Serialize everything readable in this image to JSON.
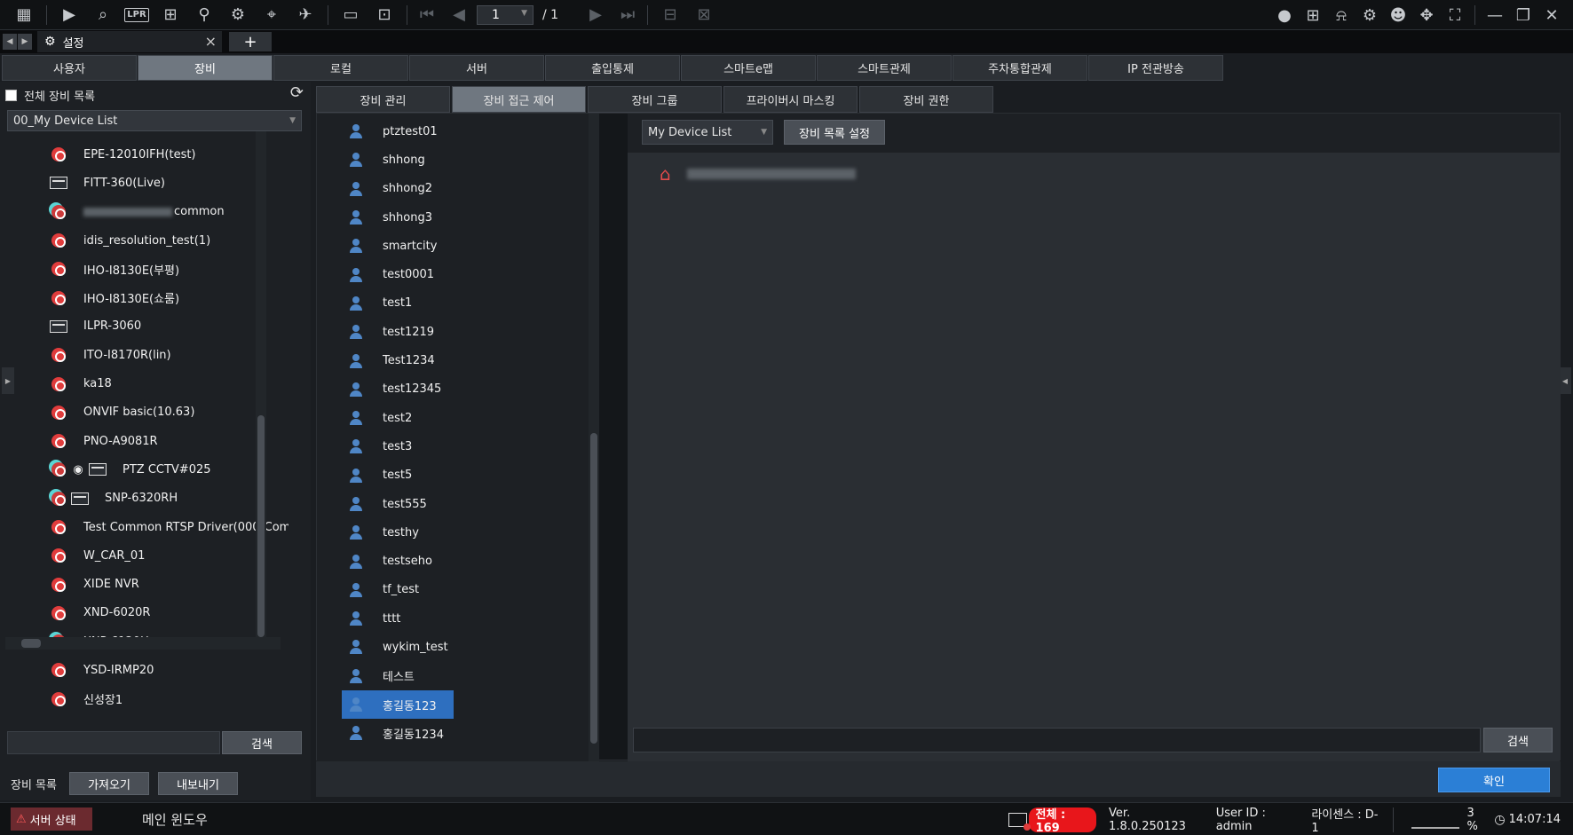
{
  "toolbar": {
    "icons_left": [
      "grid-icon",
      "playback-icon",
      "search-video-icon",
      "lpr-icon",
      "event-search-icon",
      "person-search-icon",
      "vehicle-icon",
      "map-icon",
      "broadcast-icon"
    ],
    "lpr_label": "LPR",
    "page_current": "1",
    "page_total": "/ 1",
    "icons_right": [
      "chat-icon",
      "event-icon",
      "alarm-icon",
      "gear-icon",
      "user-icon",
      "move-icon",
      "fullscreen-icon",
      "minimize-icon",
      "restore-icon",
      "close-icon"
    ]
  },
  "window_tab": {
    "label": "설정"
  },
  "main_tabs": [
    "사용자",
    "장비",
    "로컬",
    "서버",
    "출입통제",
    "스마트e맵",
    "스마트관제",
    "주차통합관제",
    "IP 전관방송"
  ],
  "main_tab_active": 1,
  "left": {
    "all_devices_label": "전체 장비 목록",
    "device_list_select": "00_My Device List",
    "devices": [
      {
        "name": "EPE-12010IFH(test)",
        "icon": "camera"
      },
      {
        "name": "FITT-360(Live)",
        "icon": "encoder"
      },
      {
        "name": "common",
        "icon": "ptz",
        "blurred": true
      },
      {
        "name": "idis_resolution_test(1)",
        "icon": "camera"
      },
      {
        "name": "IHO-I8130E(부평)",
        "icon": "camera"
      },
      {
        "name": "IHO-I8130E(쇼룸)",
        "icon": "camera"
      },
      {
        "name": "ILPR-3060",
        "icon": "encoder"
      },
      {
        "name": "ITO-I8170R(lin)",
        "icon": "camera"
      },
      {
        "name": "ka18",
        "icon": "camera"
      },
      {
        "name": "ONVIF basic(10.63)",
        "icon": "camera"
      },
      {
        "name": "PNO-A9081R",
        "icon": "camera"
      },
      {
        "name": "PTZ CCTV#025",
        "icon": "ptz-multi"
      },
      {
        "name": "SNP-6320RH",
        "icon": "ptz-encoder"
      },
      {
        "name": "Test Common RTSP Driver(000)Com",
        "icon": "camera"
      },
      {
        "name": "W_CAR_01",
        "icon": "camera"
      },
      {
        "name": "XIDE NVR",
        "icon": "camera"
      },
      {
        "name": "XND-6020R",
        "icon": "camera"
      },
      {
        "name": "XNP-6120H",
        "icon": "ptz"
      },
      {
        "name": "YSD-IRMP20",
        "icon": "camera"
      },
      {
        "name": "신성장1",
        "icon": "camera"
      }
    ],
    "search_button": "검색",
    "device_list_label": "장비 목록",
    "import_button": "가져오기",
    "export_button": "내보내기"
  },
  "sub_tabs": [
    "장비 관리",
    "장비 접근 제어",
    "장비 그룹",
    "프라이버시 마스킹",
    "장비 권한"
  ],
  "sub_tab_active": 1,
  "users": [
    "ptztest01",
    "shhong",
    "shhong2",
    "shhong3",
    "smartcity",
    "test0001",
    "test1",
    "test1219",
    "Test1234",
    "test12345",
    "test2",
    "test3",
    "test5",
    "test555",
    "testhy",
    "testseho",
    "tf_test",
    "tttt",
    "wykim_test",
    "테스트",
    "홍길동123",
    "홍길동1234"
  ],
  "user_selected": 20,
  "right": {
    "list_select": "My Device List",
    "list_settings_button": "장비 목록 설정",
    "search_button": "검색"
  },
  "ok_button": "확인",
  "status": {
    "server_status": "서버 상태",
    "main_window": "메인 윈도우",
    "total_label": "전체 : 169",
    "version": "Ver. 1.8.0.250123",
    "user_id": "User ID : admin",
    "license": "라이센스 : D-1",
    "cpu": "3 %",
    "time": "14:07:14"
  },
  "colors": {
    "accent": "#2b7fd6",
    "alert": "#e8161b",
    "selected_row": "#2e6fbf"
  }
}
